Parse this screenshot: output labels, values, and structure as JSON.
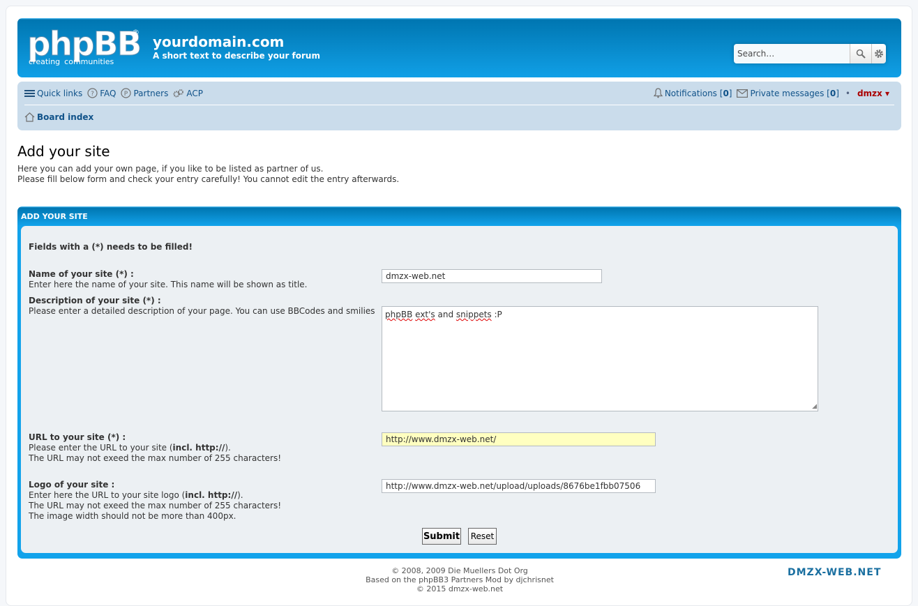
{
  "header": {
    "logo": {
      "text": "phpBB",
      "reg": "®",
      "tag1": "creating",
      "tag2": "communities"
    },
    "site_title": "yourdomain.com",
    "site_desc": "A short text to describe your forum",
    "search_placeholder": "Search…"
  },
  "navbar": {
    "quick_links": "Quick links",
    "faq": "FAQ",
    "partners": "Partners",
    "acp": "ACP",
    "notifications_label": "Notifications",
    "notifications_count": "0",
    "pm_label": "Private messages",
    "pm_count": "0",
    "separator": "•",
    "username": "dmzx",
    "board_index": "Board index"
  },
  "page": {
    "title": "Add your site",
    "intro_line1": "Here you can add your own page, if you like to be listed as partner of us.",
    "intro_line2": "Please fill below form and check your entry carefully! You cannot edit the entry afterwards."
  },
  "form": {
    "panel_title": "ADD YOUR SITE",
    "required_note": "Fields with a (*) needs to be filled!",
    "name_label": "Name of your site (*) :",
    "name_help": "Enter here the name of your site. This name will be shown as title.",
    "name_value": "dmzx-web.net",
    "desc_label": "Description of your site (*) :",
    "desc_help": "Please enter a detailed description of your page. You can use BBCodes and smilies",
    "desc_value_w1": "phpBB",
    "desc_value_w2": "ext's",
    "desc_value_w3": "and",
    "desc_value_w4": "snippets",
    "desc_value_w5": ":P",
    "url_label": "URL to your site (*) :",
    "url_help1_pre": "Please enter the URL to your site (",
    "url_help1_bold": "incl. http://",
    "url_help1_post": ").",
    "url_help2": "The URL may not exeed the max number of 255 characters!",
    "url_value": "http://www.dmzx-web.net/",
    "logo_label": "Logo of your site :",
    "logo_help1_pre": "Enter here the URL to your site logo (",
    "logo_help1_bold": "incl. http://",
    "logo_help1_post": ").",
    "logo_help2": "The URL may not exeed the max number of 255 characters!",
    "logo_help3": "The image width should not be more than 400px.",
    "logo_value": "http://www.dmzx-web.net/upload/uploads/8676be1fbb07506",
    "submit": "Submit",
    "reset": "Reset"
  },
  "footer": {
    "line1": "© 2008, 2009 Die Muellers Dot Org",
    "line2": "Based on the phpBB3 Partners Mod by djchrisnet",
    "line3": "© 2015 dmzx-web.net",
    "logo": "DMZX-WEB.NET"
  },
  "colors": {
    "accent": "#12a3eb",
    "link": "#105289",
    "username": "#aa0000",
    "navbar": "#cadceb"
  }
}
